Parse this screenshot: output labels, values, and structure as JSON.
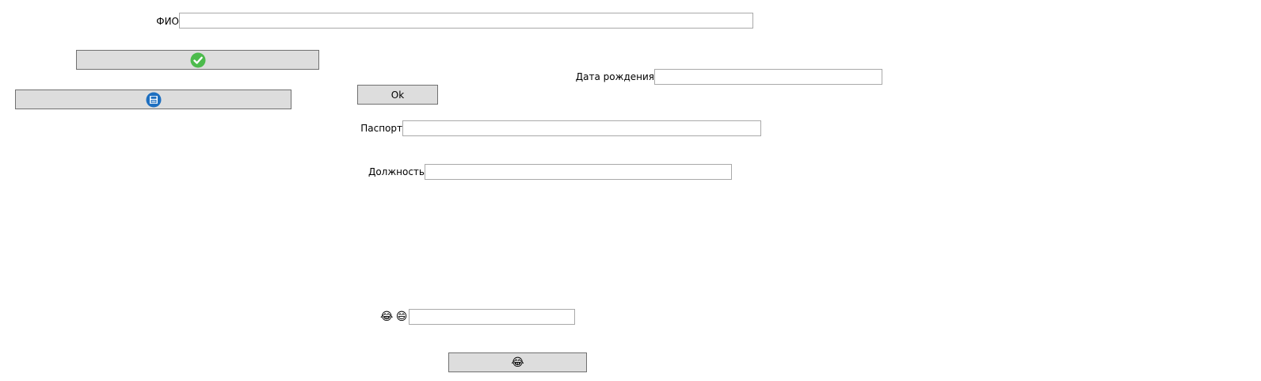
{
  "form": {
    "fio_label": "ФИО",
    "birthdate_label": "Дата рождения",
    "passport_label": "Паспорт",
    "position_label": "Должность",
    "ok_button_label": "Ok",
    "fio_value": "",
    "birthdate_value": "",
    "passport_value": "",
    "position_value": "",
    "emoji_input_value": ""
  },
  "icons": {
    "confirm_button_icon": "check-circle-icon",
    "save_button_icon": "floppy-disk-icon",
    "emoji_label_1": "😂",
    "emoji_label_2": "😄",
    "bottom_button_emoji": "😂"
  },
  "colors": {
    "check_green": "#4cbb4c",
    "save_blue": "#1e6fc0",
    "button_bg": "#dddddd"
  }
}
